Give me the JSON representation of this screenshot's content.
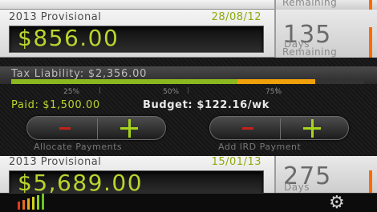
{
  "top_card_partial": {
    "remaining_label": "Remaining"
  },
  "card1": {
    "name": "2013 Provisional",
    "date": "28/08/12",
    "amount": "$856.00",
    "days_num": "135",
    "days_label": "Days",
    "remaining_label": "Remaining"
  },
  "panel": {
    "tax_liability": "Tax Liability: $2,356.00",
    "progress": {
      "paid_fraction": 0.64,
      "marker_fraction": 0.86
    },
    "ticks": [
      "25%",
      "50%",
      "75%"
    ],
    "paid": "Paid: $1,500.00",
    "budget": "Budget: $122.16/wk",
    "allocate_label": "Allocate Payments",
    "add_ird_label": "Add IRD Payment"
  },
  "card2": {
    "name": "2013 Provisional",
    "date": "15/01/13",
    "amount": "$5,689.00",
    "days_num": "275",
    "days_label": "Days"
  },
  "bottom_bar": {
    "signal_icon": "signal-bars-icon",
    "gear_icon": "gear-icon"
  },
  "colors": {
    "accent_green": "#b8d52e",
    "date_green": "#8cab0a",
    "orange": "#f0a00a",
    "minus_red": "#c2221a"
  }
}
